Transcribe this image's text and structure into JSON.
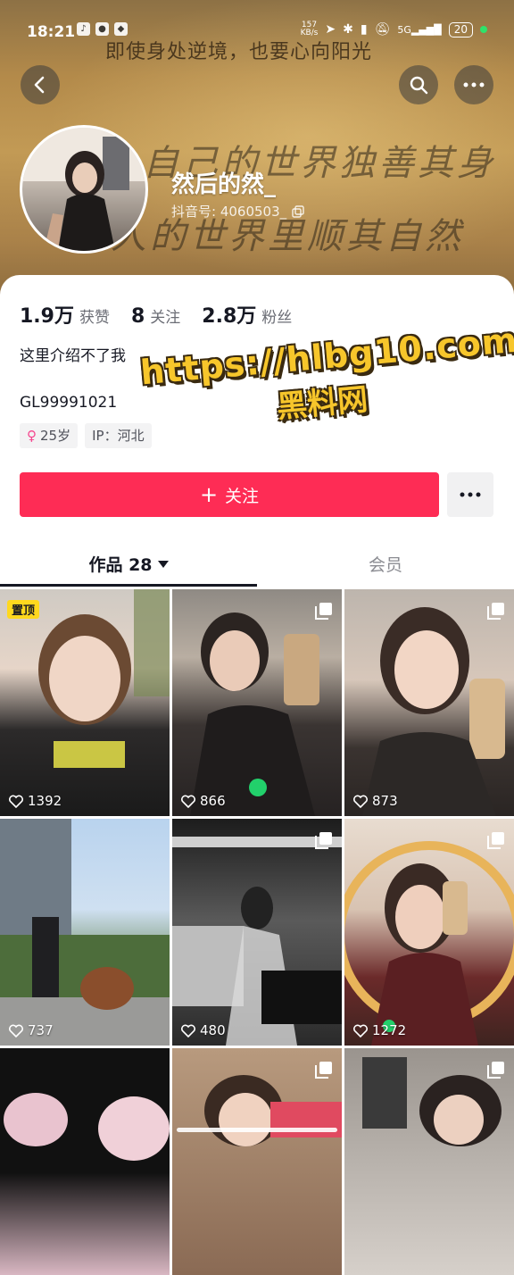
{
  "status_bar": {
    "time": "18:21",
    "speed": "157",
    "speed_unit": "KB/s",
    "network": "5G",
    "battery": "20"
  },
  "banner": {
    "line1": "即使身处逆境，也要心向阳光",
    "line2": "自己的世界独善其身",
    "line3": "别人的世界里顺其自然"
  },
  "profile": {
    "nickname": "然后的然_",
    "douyin_id": "抖音号: 4060503_",
    "stats": [
      {
        "num": "1.9万",
        "label": "获赞"
      },
      {
        "num": "8",
        "label": "关注"
      },
      {
        "num": "2.8万",
        "label": "粉丝"
      }
    ],
    "bio": "这里介绍不了我",
    "code_line": "GL99991021",
    "tags": {
      "age": "25岁",
      "ip": "IP：河北"
    }
  },
  "watermark": {
    "url": "https://hlbg10.com",
    "name": "黑料网"
  },
  "actions": {
    "follow_label": "关注"
  },
  "tabs": {
    "works_label": "作品 28",
    "member_label": "会员"
  },
  "posts": [
    {
      "likes": "1392",
      "pinned": "置顶"
    },
    {
      "likes": "866"
    },
    {
      "likes": "873"
    },
    {
      "likes": "737"
    },
    {
      "likes": "480"
    },
    {
      "likes": "1272"
    },
    {
      "likes": ""
    },
    {
      "likes": ""
    },
    {
      "likes": ""
    }
  ],
  "colors": {
    "accent": "#fe2c55",
    "pin": "#ffd81e",
    "watermark": "#f7c62b"
  }
}
